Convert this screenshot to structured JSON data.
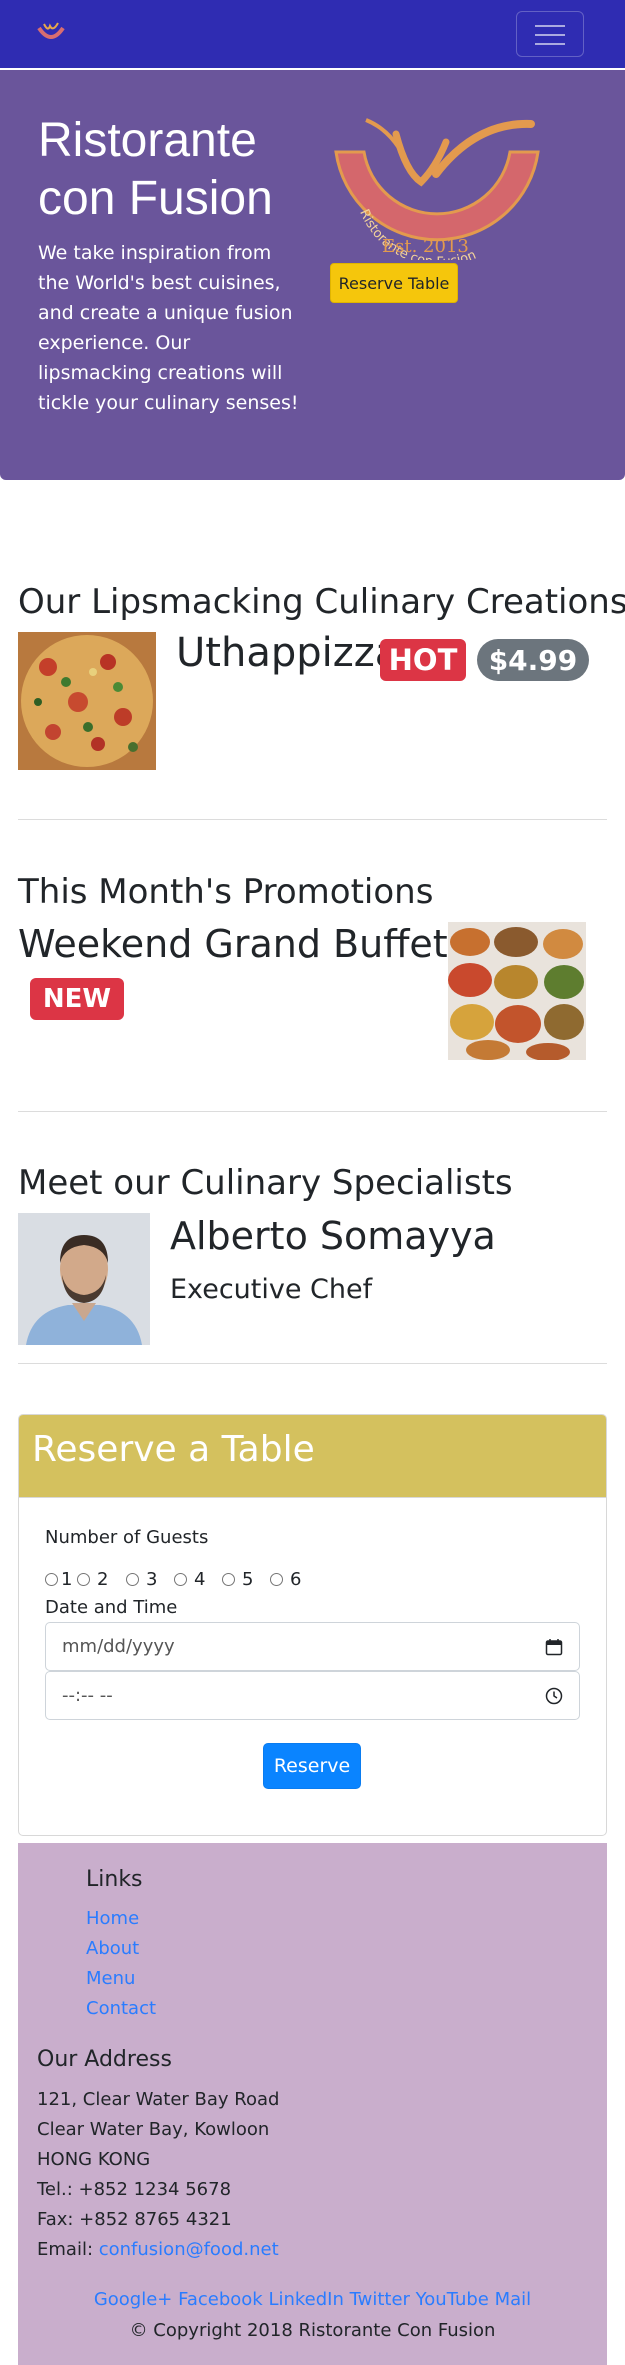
{
  "navbar": {
    "brand_logo_icon": "restaurant-logo-icon",
    "menu_icon": "hamburger-menu-icon"
  },
  "jumbotron": {
    "title": "Ristorante con Fusion",
    "text": "We take inspiration from the World's best cuisines, and create a unique fusion experience. Our lipsmacking creations will tickle your culinary senses!",
    "logo_text": "Ristorante con Fusion",
    "logo_est": "Est. 2013",
    "reserve_button": "Reserve Table"
  },
  "dish": {
    "section_title": "Our Lipsmacking Culinary Creations",
    "name": "Uthappizza",
    "label": "HOT",
    "price": "$4.99"
  },
  "promotion": {
    "section_title": "This Month's Promotions",
    "name": "Weekend Grand Buffet",
    "label": "NEW"
  },
  "leader": {
    "section_title": "Meet our Culinary Specialists",
    "name": "Alberto Somayya",
    "designation": "Executive Chef"
  },
  "reservation": {
    "title": "Reserve a Table",
    "guests_label": "Number of Guests",
    "guest_options": [
      "1",
      "2",
      "3",
      "4",
      "5",
      "6"
    ],
    "datetime_label": "Date and Time",
    "date_placeholder": "mm/dd/yyyy",
    "time_placeholder": "--:-- --",
    "submit_button": "Reserve"
  },
  "footer": {
    "links_heading": "Links",
    "links": [
      "Home",
      "About",
      "Menu",
      "Contact"
    ],
    "address_heading": "Our Address",
    "address_lines": [
      "121, Clear Water Bay Road",
      "Clear Water Bay, Kowloon",
      "HONG KONG"
    ],
    "tel": "Tel.: +852 1234 5678",
    "fax": "Fax: +852 8765 4321",
    "email_label": "Email: ",
    "email": "confusion@food.net",
    "social": [
      "Google+",
      "Facebook",
      "LinkedIn",
      "Twitter",
      "YouTube",
      "Mail"
    ],
    "copyright": "© Copyright 2018 Ristorante Con Fusion"
  },
  "colors": {
    "navbar": "#2f2cb2",
    "jumbotron": "#6a559b",
    "reserve_header": "#d4c15e",
    "footer": "#c9aecc",
    "link": "#2a7cff",
    "badge_red": "#dc3545",
    "badge_gray": "#6c757d",
    "button_yellow": "#f5c60c",
    "button_blue": "#0a84ff"
  }
}
